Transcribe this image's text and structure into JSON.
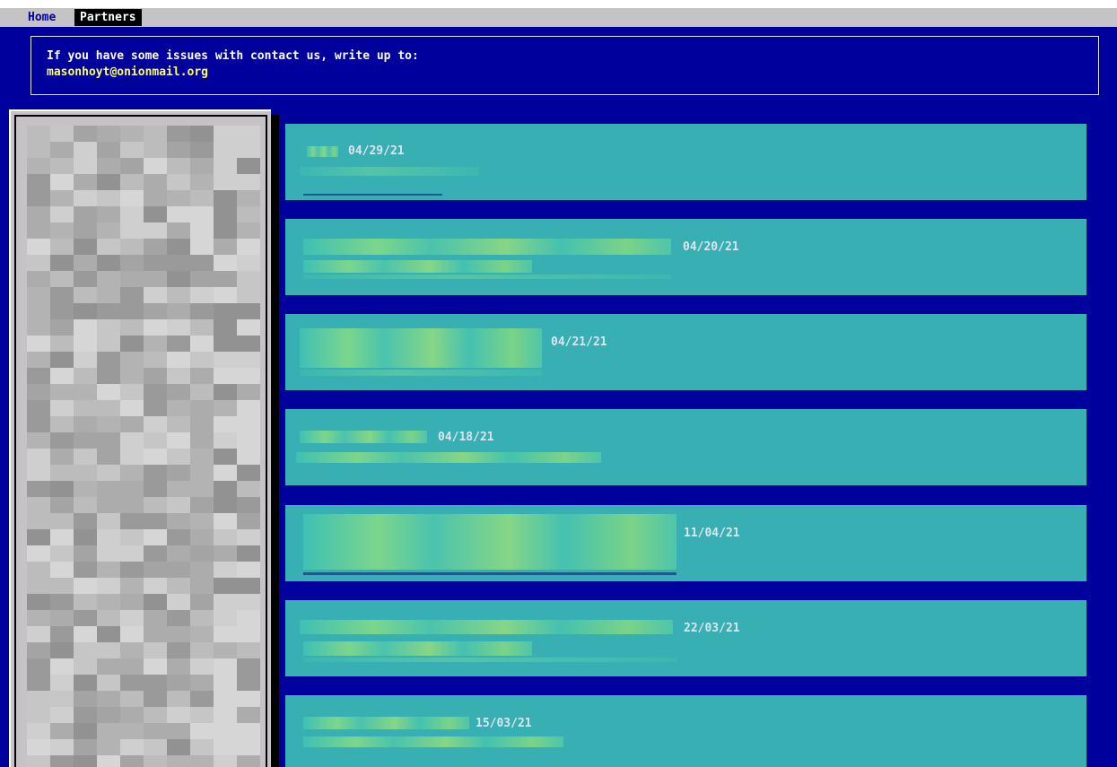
{
  "menu": {
    "home_label": "Home",
    "partners_label": "Partners"
  },
  "notice": {
    "text": "If you have some issues with contact us, write up to:",
    "email": "masonhoyt@onionmail.org"
  },
  "news": [
    {
      "date": "04/29/21"
    },
    {
      "date": "04/20/21"
    },
    {
      "date": "04/21/21"
    },
    {
      "date": "04/18/21"
    },
    {
      "date": "11/04/21"
    },
    {
      "date": "22/03/21"
    },
    {
      "date": "15/03/21"
    }
  ],
  "colors": {
    "background": "#00009c",
    "menubar": "#c6c3c6",
    "card": "#38b0b3",
    "email": "#ffff55",
    "date_text": "#dde4ef"
  }
}
